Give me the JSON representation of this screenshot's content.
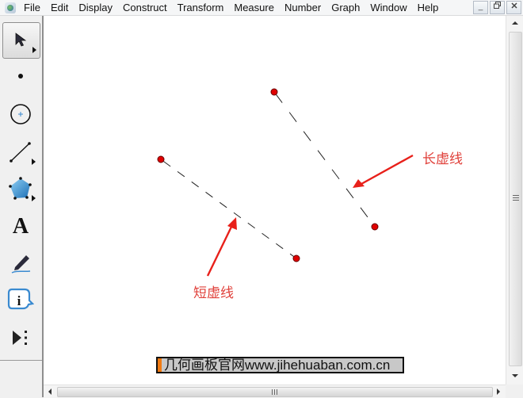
{
  "menubar": {
    "app_icon": "geometers-sketchpad-icon",
    "items": [
      "File",
      "Edit",
      "Display",
      "Construct",
      "Transform",
      "Measure",
      "Number",
      "Graph",
      "Window",
      "Help"
    ],
    "window_controls": [
      "minimize",
      "restore",
      "close"
    ],
    "window_control_glyphs": [
      "_",
      "🗗",
      "✕"
    ]
  },
  "toolbox": {
    "tools": [
      {
        "name": "selection-arrow-tool",
        "selected": true,
        "has_submenu": true
      },
      {
        "name": "point-tool",
        "selected": false,
        "has_submenu": false
      },
      {
        "name": "compass-tool",
        "selected": false,
        "has_submenu": false
      },
      {
        "name": "straightedge-tool",
        "selected": false,
        "has_submenu": true
      },
      {
        "name": "polygon-tool",
        "selected": false,
        "has_submenu": true
      },
      {
        "name": "text-tool",
        "selected": false,
        "has_submenu": false,
        "glyph": "A"
      },
      {
        "name": "marker-tool",
        "selected": false,
        "has_submenu": false
      },
      {
        "name": "information-tool",
        "selected": false,
        "has_submenu": false,
        "glyph": "i"
      },
      {
        "name": "custom-tools",
        "selected": false,
        "has_submenu": false
      }
    ]
  },
  "sketch": {
    "segments": [
      {
        "name": "long-dashed-segment",
        "style": "long-dash"
      },
      {
        "name": "short-dashed-segment",
        "style": "short-dash"
      }
    ],
    "point_color": "#e00000",
    "annotation_color": "#e0403a",
    "labels": {
      "long_dash": "长虚线",
      "short_dash": "短虚线"
    }
  },
  "watermark": {
    "text": "几何画板官网www.jihehuaban.com.cn",
    "accent_color": "#f07a12"
  }
}
